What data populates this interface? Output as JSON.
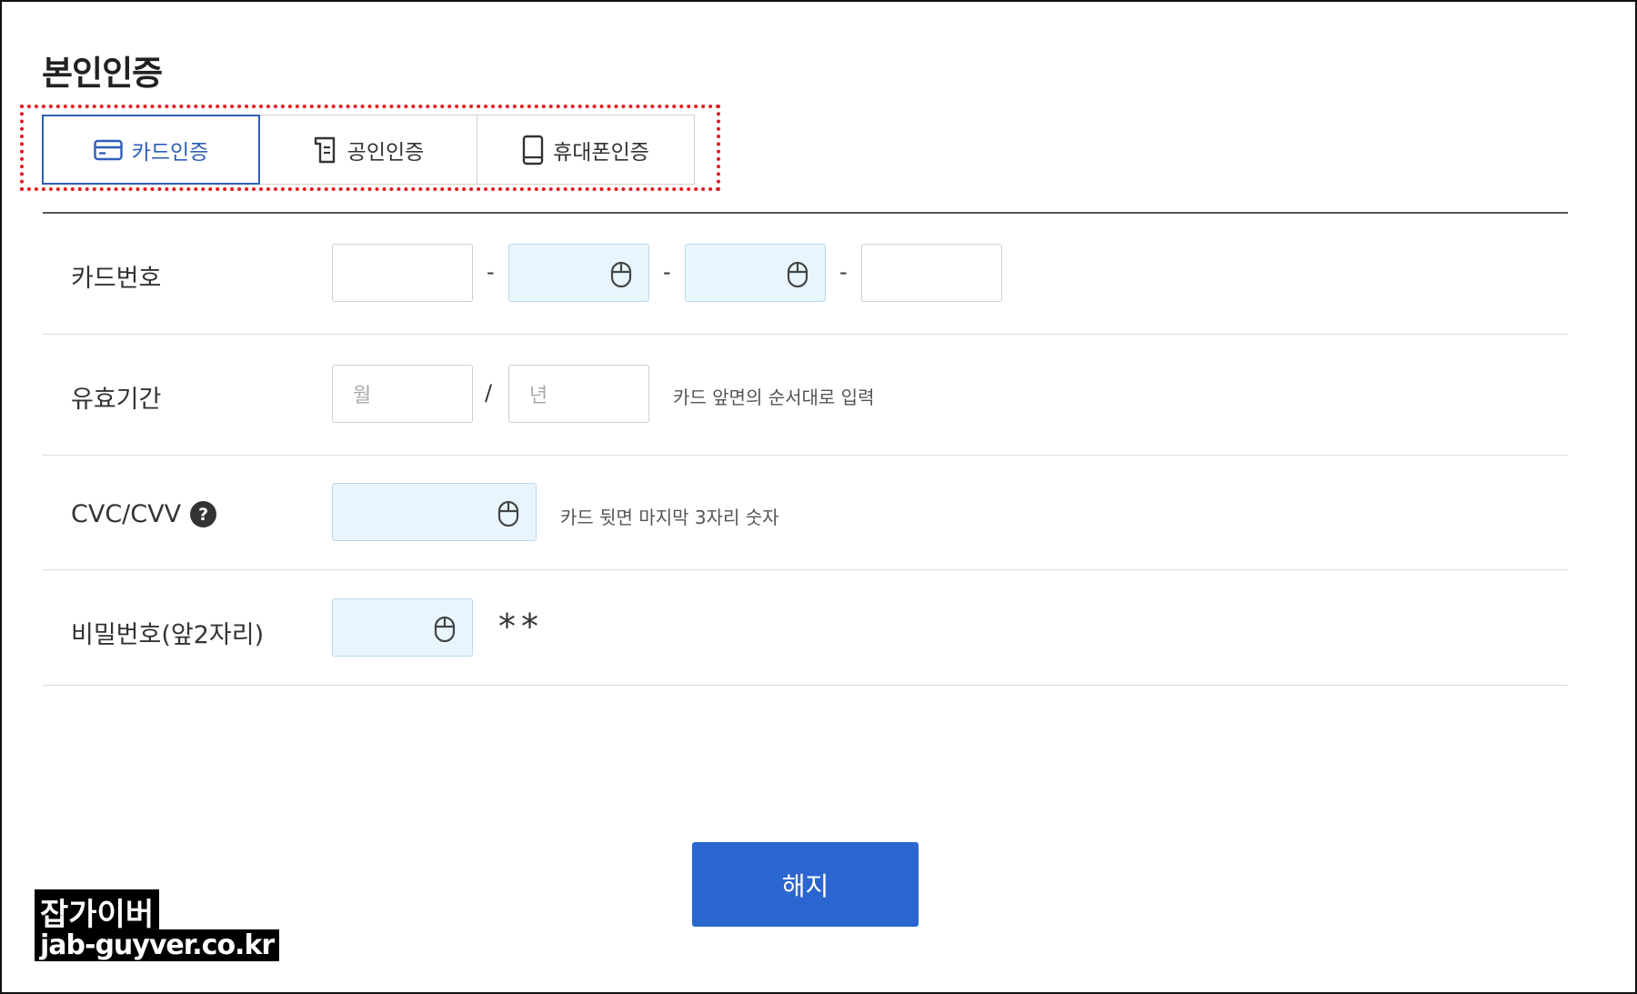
{
  "page": {
    "title": "본인인증"
  },
  "tabs": [
    {
      "label": "카드인증",
      "icon": "credit-card-icon",
      "active": true
    },
    {
      "label": "공인인증",
      "icon": "certificate-icon",
      "active": false
    },
    {
      "label": "휴대폰인증",
      "icon": "mobile-phone-icon",
      "active": false
    }
  ],
  "form": {
    "card_number": {
      "label": "카드번호",
      "separator": "-"
    },
    "expiry": {
      "label": "유효기간",
      "month_placeholder": "월",
      "year_placeholder": "년",
      "separator": "/",
      "hint": "카드 앞면의 순서대로 입력"
    },
    "cvc": {
      "label": "CVC/CVV",
      "help": "?",
      "hint": "카드 뒷면 마지막 3자리 숫자"
    },
    "password": {
      "label": "비밀번호(앞2자리)",
      "suffix": "**"
    }
  },
  "actions": {
    "cancel_label": "해지"
  },
  "watermark": {
    "name": "잡가이버",
    "url": "jab-guyver.co.kr"
  },
  "colors": {
    "accent": "#2b66d0",
    "tab_active": "#2d5fb8",
    "secure_field_bg": "#e9f5fd",
    "highlight_dotted": "#e3181f"
  }
}
